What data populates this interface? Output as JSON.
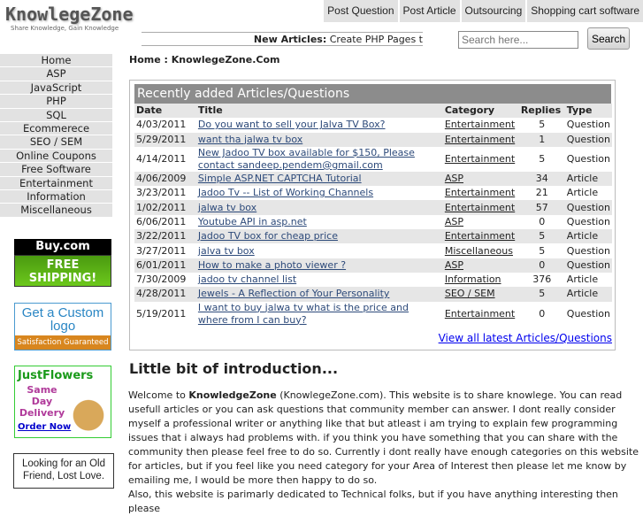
{
  "logo": {
    "title": "KnowlegeZone",
    "tagline": "Share Knowledge, Gain Knowledge"
  },
  "topnav": [
    "Post Question",
    "Post Article",
    "Outsourcing",
    "Shopping cart software"
  ],
  "ticker": {
    "label": "New Articles:",
    "text": "Create PHP Pages t"
  },
  "search": {
    "placeholder": "Search here...",
    "button": "Search"
  },
  "sidebar": [
    "Home",
    "ASP",
    "JavaScript",
    "PHP",
    "SQL",
    "Ecommerece",
    "SEO / SEM",
    "Online Coupons",
    "Free Software",
    "Entertainment",
    "Information",
    "Miscellaneous"
  ],
  "ads": {
    "buy": {
      "top": "Buy.com",
      "bottom": "FREE SHIPPING!"
    },
    "logo": {
      "top": "Get a Custom logo",
      "bottom": "Satisfaction Guaranteed"
    },
    "flowers": {
      "title": "JustFlowers",
      "text": "Same Day Delivery",
      "link": "Order Now"
    },
    "friend": {
      "text": "Looking for an Old Friend, Lost Love."
    }
  },
  "breadcrumb": "Home : KnowlegeZone.Com",
  "recent": {
    "title": "Recently added Articles/Questions",
    "columns": [
      "Date",
      "Title",
      "Category",
      "Replies",
      "Type"
    ],
    "rows": [
      [
        "4/03/2011",
        "Do you want to sell your Jalva TV Box?",
        "Entertainment",
        "5",
        "Question"
      ],
      [
        "5/29/2011",
        "want tha jalwa tv box",
        "Entertainment",
        "1",
        "Question"
      ],
      [
        "4/14/2011",
        "New Jadoo TV box available for $150, Please contact sandeep.pendem@gmail.com",
        "Entertainment",
        "5",
        "Question"
      ],
      [
        "4/06/2009",
        "Simple ASP.NET CAPTCHA Tutorial",
        "ASP",
        "34",
        "Article"
      ],
      [
        "3/23/2011",
        "Jadoo Tv -- List of Working Channels",
        "Entertainment",
        "21",
        "Article"
      ],
      [
        "1/02/2011",
        "jalwa tv box",
        "Entertainment",
        "57",
        "Question"
      ],
      [
        "6/06/2011",
        "Youtube API in asp.net",
        "ASP",
        "0",
        "Question"
      ],
      [
        "3/22/2011",
        "Jadoo TV box for cheap price",
        "Entertainment",
        "5",
        "Article"
      ],
      [
        "3/27/2011",
        "jalva tv box",
        "Miscellaneous",
        "5",
        "Question"
      ],
      [
        "6/01/2011",
        "How to make a photo viewer ?",
        "ASP",
        "0",
        "Question"
      ],
      [
        "7/30/2009",
        "jadoo tv channel list",
        "Information",
        "376",
        "Article"
      ],
      [
        "4/28/2011",
        "Jewels - A Reflection of Your Personality",
        "SEO / SEM",
        "5",
        "Article"
      ],
      [
        "5/19/2011",
        "I want to buy jalwa tv what is the price and where from I can buy?",
        "Entertainment",
        "0",
        "Question"
      ]
    ],
    "view_all": "View all latest Articles/Questions"
  },
  "intro": {
    "heading": "Little bit of introduction...",
    "p1_pre": "Welcome to ",
    "p1_bold": "KnowledgeZone",
    "p1_post": " (KnowlegeZone.com). This website is to share knowlege. You can read usefull articles or you can ask questions that community member can answer. I dont really consider myself a professional writer or anything like that but atleast i am trying to explain few programming issues that i always had problems with. if you think you have something that you can share with the community then please feel free to do so. Currently i dont really have enough categories on this website for articles, but if you feel like you need category for your Area of Interest then please let me know by emailing me, I would be more then happy to do so.",
    "p2": "Also, this website is parimarly dedicated to Technical folks, but if you have anything interesting then please"
  }
}
